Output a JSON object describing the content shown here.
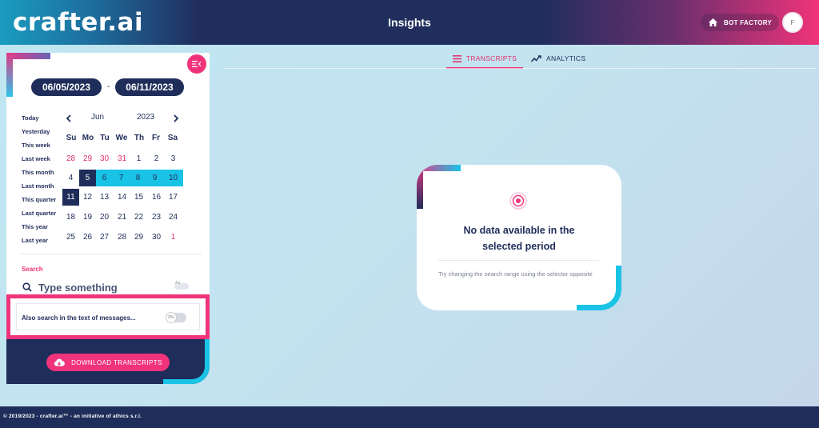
{
  "header": {
    "logo": "crafter.ai",
    "title": "Insights",
    "bot_factory_label": "BOT FACTORY",
    "avatar_initial": "F"
  },
  "date_range": {
    "start": "06/05/2023",
    "separator": "-",
    "end": "06/11/2023"
  },
  "presets": [
    "Today",
    "Yesterday",
    "This week",
    "Last week",
    "This month",
    "Last month",
    "This quarter",
    "Last quarter",
    "This year",
    "Last year"
  ],
  "calendar": {
    "month": "Jun",
    "year": "2023",
    "prev_icon": "chevron-left-icon",
    "next_icon": "chevron-right-icon",
    "weekdays": [
      "Su",
      "Mo",
      "Tu",
      "We",
      "Th",
      "Fr",
      "Sa"
    ],
    "weeks": [
      [
        "28",
        "29",
        "30",
        "31",
        "1",
        "2",
        "3"
      ],
      [
        "4",
        "5",
        "6",
        "7",
        "8",
        "9",
        "10"
      ],
      [
        "11",
        "12",
        "13",
        "14",
        "15",
        "16",
        "17"
      ],
      [
        "18",
        "19",
        "20",
        "21",
        "22",
        "23",
        "24"
      ],
      [
        "25",
        "26",
        "27",
        "28",
        "29",
        "30",
        "1"
      ]
    ],
    "selected_start": "5",
    "selected_end": "11"
  },
  "search": {
    "title": "Search",
    "placeholder": "Type something",
    "case_toggle_label": "Aa",
    "also_search_label": "Also search in the text of messages...",
    "also_search_toggle": "0%"
  },
  "download_label": "DOWNLOAD TRANSCRIPTS",
  "tabs": [
    {
      "label": "TRANSCRIPTS",
      "icon": "list-icon",
      "active": true
    },
    {
      "label": "ANALYTICS",
      "icon": "trend-icon",
      "active": false
    }
  ],
  "empty_state": {
    "title_line1": "No data available in the",
    "title_line2": "selected period",
    "hint": "Try changing the search range using the selector opposite",
    "icon": "target-icon"
  },
  "footer": {
    "text": "© 2019/2023 - crafter.ai™ - an initiative of athics s.r.l."
  },
  "colors": {
    "navy": "#1f2d5a",
    "pink": "#f0337a",
    "cyan": "#19c3e6"
  }
}
